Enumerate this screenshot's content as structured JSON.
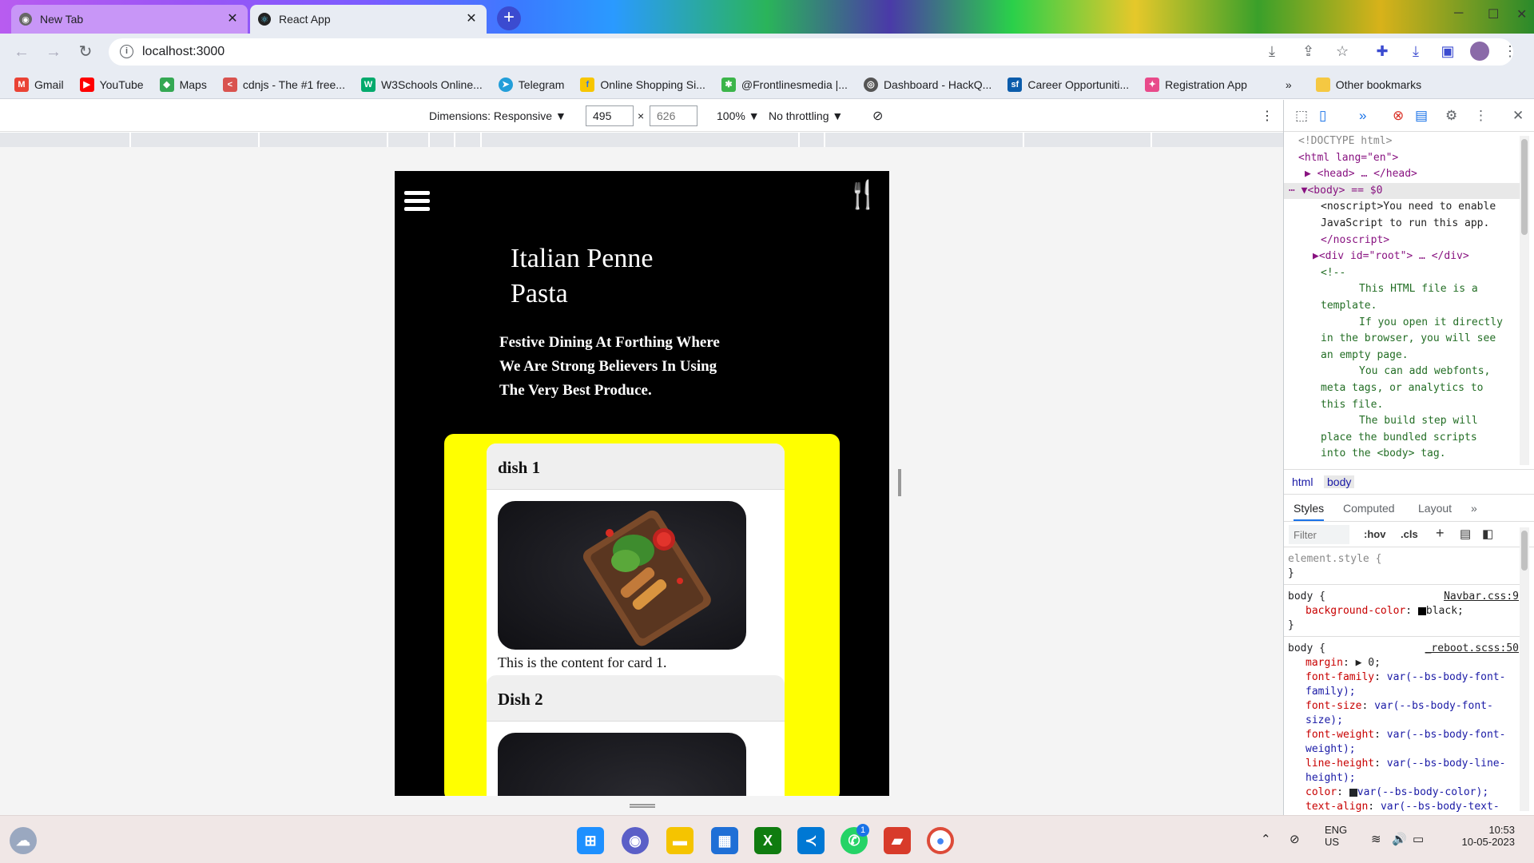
{
  "browser": {
    "tabs": [
      {
        "title": "New Tab",
        "active": false
      },
      {
        "title": "React App",
        "active": true
      }
    ],
    "url": "localhost:3000",
    "bookmarks": [
      {
        "label": "Gmail",
        "icon": "gmail-icon",
        "color": "#ea4335"
      },
      {
        "label": "YouTube",
        "icon": "youtube-icon",
        "color": "#ff0000"
      },
      {
        "label": "Maps",
        "icon": "maps-icon",
        "color": "#34a853"
      },
      {
        "label": "cdnjs - The #1 free...",
        "icon": "cdnjs-icon",
        "color": "#d9534f"
      },
      {
        "label": "W3Schools Online...",
        "icon": "w3schools-icon",
        "color": "#04aa6d"
      },
      {
        "label": "Telegram",
        "icon": "telegram-icon",
        "color": "#229ed9"
      },
      {
        "label": "Online Shopping Si...",
        "icon": "flipkart-icon",
        "color": "#f7c600"
      },
      {
        "label": "@Frontlinesmedia |...",
        "icon": "frontlines-icon",
        "color": "#3bb54a"
      },
      {
        "label": "Dashboard - HackQ...",
        "icon": "hackq-icon",
        "color": "#555555"
      },
      {
        "label": "Career Opportuniti...",
        "icon": "salesforce-icon",
        "color": "#0b5cab"
      },
      {
        "label": "Registration App",
        "icon": "registration-icon",
        "color": "#e84a8a"
      }
    ],
    "more_bookmarks": "»",
    "other_bookmarks": "Other bookmarks"
  },
  "device_toolbar": {
    "dimensions_label": "Dimensions: Responsive",
    "width": "495",
    "height_placeholder": "626",
    "times": "×",
    "zoom": "100%",
    "throttle": "No throttling"
  },
  "app": {
    "title": "Italian Penne Pasta",
    "subtitle": "Festive Dining At Forthing Where We Are Strong Believers In Using The Very Best Produce.",
    "cards": [
      {
        "heading": "dish 1",
        "content": "This is the content for card 1."
      },
      {
        "heading": "Dish 2",
        "content": ""
      }
    ]
  },
  "devtools": {
    "elements": [
      {
        "text": "<!DOCTYPE html>"
      },
      {
        "text": "<html lang=\"en\">"
      },
      {
        "text": "<head> … </head>"
      },
      {
        "text": "<body> == $0"
      },
      {
        "text": "<noscript>You need to enable"
      },
      {
        "text": "JavaScript to run this app."
      },
      {
        "text": "</noscript>"
      },
      {
        "text": "<div id=\"root\"> … </div>"
      },
      {
        "text": "<!--"
      },
      {
        "text": "This HTML file is a"
      },
      {
        "text": "template."
      },
      {
        "text": "If you open it directly"
      },
      {
        "text": "in the browser, you will see"
      },
      {
        "text": "an empty page."
      },
      {
        "text": "You can add webfonts,"
      },
      {
        "text": "meta tags, or analytics to"
      },
      {
        "text": "this file."
      },
      {
        "text": "The build step will"
      },
      {
        "text": "place the bundled scripts"
      },
      {
        "text": "into the <body> tag."
      }
    ],
    "breadcrumbs": [
      "html",
      "body"
    ],
    "style_tabs": [
      "Styles",
      "Computed",
      "Layout",
      "»"
    ],
    "filter_placeholder": "Filter",
    "hov": ":hov",
    "cls": ".cls",
    "rules": {
      "element_style": "element.style {",
      "close": "}",
      "body1_selector": "body {",
      "body1_source": "Navbar.css:9",
      "body1_prop": "background-color",
      "body1_val": "black;",
      "body2_selector": "body {",
      "body2_source": "_reboot.scss:50",
      "margin_prop": "margin",
      "margin_val": "▶ 0;",
      "ff_prop": "font-family",
      "ff_val": "var(--bs-body-font-family);",
      "fs_prop": "font-size",
      "fs_val": "var(--bs-body-font-size);",
      "fw_prop": "font-weight",
      "fw_val": "var(--bs-body-font-weight);",
      "lh_prop": "line-height",
      "lh_val": "var(--bs-body-line-height);",
      "color_prop": "color",
      "color_val": "var(--bs-body-color);",
      "ta_prop": "text-align",
      "ta_val": "var(--bs-body-text-"
    }
  },
  "taskbar": {
    "whatsapp_badge": "1",
    "lang": "ENG",
    "region": "US",
    "time": "10:53",
    "date": "10-05-2023"
  },
  "colors": {
    "accent_yellow": "#ffff00",
    "app_bg": "#000000",
    "fork_icon": "#f5a51b"
  }
}
